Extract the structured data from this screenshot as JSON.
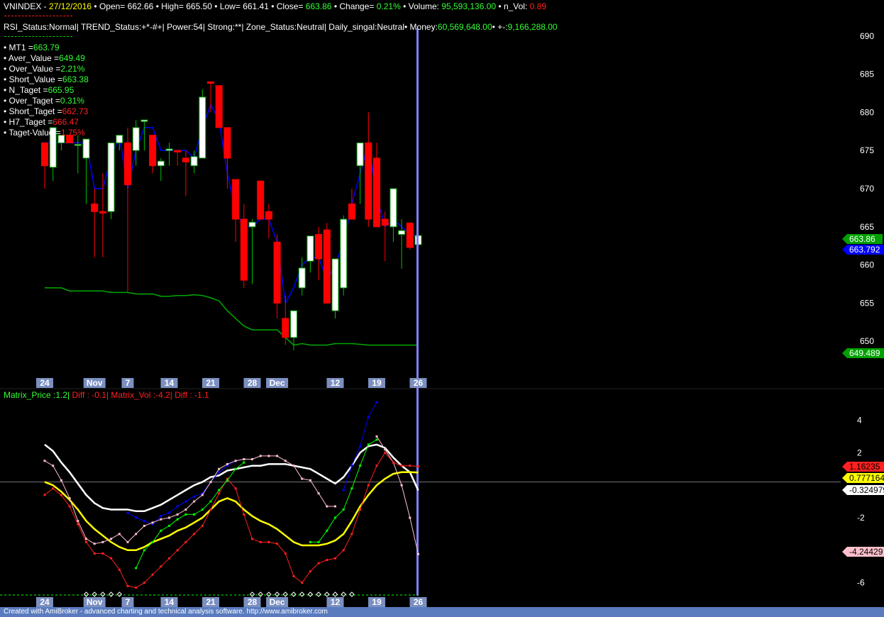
{
  "header": {
    "line1": [
      {
        "label": "VNINDEX",
        "value": "",
        "lc": "white"
      },
      {
        "label": " - ",
        "value": "27/12/2016",
        "lc": "white",
        "vc": "yellow"
      },
      {
        "label": " • Open= ",
        "value": "662.66",
        "lc": "white",
        "vc": "white"
      },
      {
        "label": " • High= ",
        "value": "665.50",
        "lc": "white",
        "vc": "white"
      },
      {
        "label": " • Low= ",
        "value": "661.41",
        "lc": "white",
        "vc": "white"
      },
      {
        "label": " • Close= ",
        "value": "663.86",
        "lc": "white",
        "vc": "lime"
      },
      {
        "label": " • Change= ",
        "value": "0.21%",
        "lc": "white",
        "vc": "lime"
      },
      {
        "label": " • Volume: ",
        "value": "95,593,136.00",
        "lc": "white",
        "vc": "lime"
      },
      {
        "label": " • n_Vol: ",
        "value": "0.89",
        "lc": "white",
        "vc": "red"
      }
    ],
    "line2": [
      {
        "label": "RSI_Status:",
        "value": "Normal",
        "lc": "white",
        "vc": "white"
      },
      {
        "label": "| TREND_Status:",
        "value": "+*-#+",
        "lc": "white",
        "vc": "white"
      },
      {
        "label": "| Power:",
        "value": "54",
        "lc": "white",
        "vc": "white"
      },
      {
        "label": "| Strong:",
        "value": "**",
        "lc": "white",
        "vc": "white"
      },
      {
        "label": "| Zone_Status:",
        "value": "Neutral",
        "lc": "white",
        "vc": "white"
      },
      {
        "label": "| Daily_singal:",
        "value": "Neutral",
        "lc": "white",
        "vc": "white"
      },
      {
        "label": "• Money:",
        "value": "60,569,648.00",
        "lc": "white",
        "vc": "lime"
      },
      {
        "label": "• +-:",
        "value": "9,166,288.00",
        "lc": "white",
        "vc": "lime"
      }
    ],
    "stats": [
      {
        "label": "• MT1 =",
        "value": "663.79",
        "vc": "lime"
      },
      {
        "label": "• Aver_Value =",
        "value": "649.49",
        "vc": "lime"
      },
      {
        "label": "• Over_Value =",
        "value": "2.21%",
        "vc": "lime"
      },
      {
        "label": "• Short_Value =",
        "value": "663.38",
        "vc": "lime"
      },
      {
        "label": "• N_Taget =",
        "value": "665.95",
        "vc": "lime"
      },
      {
        "label": "• Over_Taget =",
        "value": "0.31%",
        "vc": "lime"
      },
      {
        "label": "• Short_Taget =",
        "value": "662.73",
        "vc": "red"
      },
      {
        "label": "• H7_Taget =",
        "value": "666.47",
        "vc": "red"
      },
      {
        "label": "• Taget-Value =",
        "value": "1.75%",
        "vc": "red"
      }
    ]
  },
  "lower_header": [
    {
      "text": "Matrix_Price :1.2|",
      "color": "lime"
    },
    {
      "text": "  Diff : -0.1|",
      "color": "red"
    },
    {
      "text": " Matrix_Vol :-4.2|",
      "color": "red"
    },
    {
      "text": "  Diff : -1.1",
      "color": "red"
    }
  ],
  "footer": "Created with AmiBroker - advanced charting and technical analysis software. http://www.amibroker.com",
  "colors": {
    "up_body": "#ffffff",
    "down_body": "#ff0000",
    "ma": "#0000ff",
    "aver": "#00aa00",
    "cursor": "#8080ff",
    "badge_date": "#7b8fc0"
  },
  "chart_data": [
    {
      "type": "candlestick",
      "title": "",
      "ylim": [
        649,
        691
      ],
      "yticks": [
        650,
        655,
        660,
        665,
        670,
        675,
        680,
        685,
        690
      ],
      "x_tick_labels": [
        {
          "label": "24",
          "i": 0
        },
        {
          "label": "Nov",
          "i": 6
        },
        {
          "label": "7",
          "i": 10
        },
        {
          "label": "14",
          "i": 15
        },
        {
          "label": "21",
          "i": 20
        },
        {
          "label": "28",
          "i": 25
        },
        {
          "label": "Dec",
          "i": 28
        },
        {
          "label": "12",
          "i": 35
        },
        {
          "label": "19",
          "i": 40
        },
        {
          "label": "26",
          "i": 45
        }
      ],
      "ohlc": [
        [
          676,
          676,
          670,
          673
        ],
        [
          672.8,
          678,
          671,
          678
        ],
        [
          676,
          677,
          675,
          677
        ],
        [
          677,
          677,
          676,
          676
        ],
        [
          675.8,
          677,
          672,
          675.8
        ],
        [
          674,
          676.5,
          668,
          676.5
        ],
        [
          668,
          670,
          661,
          667
        ],
        [
          667,
          672,
          661,
          666.8
        ],
        [
          667,
          676,
          666,
          676
        ],
        [
          676,
          677,
          675,
          677
        ],
        [
          676,
          678,
          656.5,
          670.5
        ],
        [
          675,
          679,
          673,
          678
        ],
        [
          678.8,
          679,
          675,
          679
        ],
        [
          677,
          677,
          672,
          673
        ],
        [
          673,
          674,
          671,
          673.6
        ],
        [
          675,
          676,
          673,
          675.2
        ],
        [
          675,
          675,
          673,
          674.8
        ],
        [
          674,
          675,
          669,
          673.5
        ],
        [
          673,
          675,
          672,
          674.2
        ],
        [
          674,
          683,
          674,
          682
        ],
        [
          684,
          684,
          680,
          683.8
        ],
        [
          683.5,
          683.5,
          678,
          678
        ],
        [
          678,
          678,
          670,
          674
        ],
        [
          671.2,
          671.2,
          663,
          666
        ],
        [
          666,
          668,
          657,
          658
        ],
        [
          665,
          666,
          657.5,
          665.6
        ],
        [
          671,
          671,
          666,
          666
        ],
        [
          667,
          668,
          663.5,
          666
        ],
        [
          663,
          664,
          653,
          655
        ],
        [
          653,
          656,
          649.5,
          650.5
        ],
        [
          650.5,
          654,
          648.8,
          654
        ],
        [
          657,
          661,
          656,
          659.6
        ],
        [
          660.5,
          662,
          659,
          663.8
        ],
        [
          664,
          665,
          658,
          660.8
        ],
        [
          664.6,
          665.5,
          660,
          655
        ],
        [
          654,
          655,
          653,
          660.8
        ],
        [
          657,
          666.5,
          656,
          666
        ],
        [
          668,
          670,
          667,
          666
        ],
        [
          673,
          676,
          668,
          676
        ],
        [
          676,
          680,
          665,
          666
        ],
        [
          674,
          676,
          669,
          665
        ],
        [
          666,
          667,
          660.5,
          665.2
        ],
        [
          665,
          670,
          663,
          670
        ],
        [
          664,
          666,
          659.5,
          664.5
        ],
        [
          665.5,
          665.5,
          662,
          662.3
        ],
        [
          662.66,
          665.5,
          661.41,
          663.86
        ]
      ],
      "series": [
        {
          "name": "",
          "role": "ma",
          "values": [
            676,
            676,
            676,
            676,
            676,
            676,
            670,
            670,
            674,
            677,
            670,
            675,
            678,
            678,
            675,
            675,
            675,
            675,
            674,
            678,
            681,
            679,
            672,
            667,
            665,
            665,
            666,
            666,
            663,
            655,
            657,
            660,
            661,
            661,
            658,
            660,
            663,
            668,
            672,
            676,
            669,
            665,
            666,
            665,
            664,
            663.8
          ]
        },
        {
          "name": "",
          "role": "aver",
          "values": [
            657,
            657,
            657,
            656.6,
            656.6,
            656.6,
            656.6,
            656.6,
            656.4,
            656.4,
            656.4,
            656.2,
            656.2,
            656.2,
            655.9,
            655.9,
            656,
            656,
            656.1,
            656,
            655.7,
            655.3,
            654,
            653,
            652,
            651.5,
            651.5,
            651.5,
            651.5,
            650.5,
            649.5,
            649.7,
            649.5,
            649.5,
            649.5,
            649.7,
            649.7,
            649.7,
            649.6,
            649.5,
            649.5,
            649.5,
            649.5,
            649.5,
            649.5,
            649.5
          ]
        }
      ],
      "value_labels": [
        {
          "text": "663.86",
          "color": "#00a000",
          "value": 663.86
        },
        {
          "text": "663.792",
          "color": "#0000ff",
          "value": 663.792
        },
        {
          "text": "649.489",
          "color": "#00a000",
          "value": 649.489
        }
      ]
    },
    {
      "type": "line",
      "title": "",
      "ylim": [
        -6.8,
        5.2
      ],
      "yticks": [
        4,
        2,
        -2,
        -4,
        -6
      ],
      "zero_line": 0,
      "x_tick_labels": [
        {
          "label": "24",
          "i": 0
        },
        {
          "label": "Nov",
          "i": 6
        },
        {
          "label": "7",
          "i": 10
        },
        {
          "label": "14",
          "i": 15
        },
        {
          "label": "21",
          "i": 20
        },
        {
          "label": "28",
          "i": 25
        },
        {
          "label": "Dec",
          "i": 28
        },
        {
          "label": "12",
          "i": 35
        },
        {
          "label": "19",
          "i": 40
        },
        {
          "label": "26",
          "i": 45
        }
      ],
      "series": [
        {
          "name": "",
          "color": "#ffffff",
          "width": 2.5,
          "values": [
            2.5,
            2.1,
            1.4,
            0.8,
            0.1,
            -0.6,
            -1.1,
            -1.4,
            -1.5,
            -1.5,
            -1.5,
            -1.6,
            -1.6,
            -1.4,
            -1.2,
            -0.9,
            -0.6,
            -0.3,
            0.0,
            0.2,
            0.5,
            0.6,
            0.9,
            1.0,
            1.1,
            1.2,
            1.2,
            1.3,
            1.3,
            1.3,
            1.2,
            1.1,
            1.0,
            0.7,
            0.4,
            0.1,
            0.5,
            1.2,
            2.0,
            2.4,
            2.5,
            2.3,
            1.7,
            1.2,
            0.8,
            -0.32
          ]
        },
        {
          "name": "",
          "color": "#ffff00",
          "width": 2.5,
          "values": [
            0.2,
            0.0,
            -0.4,
            -0.9,
            -1.5,
            -2.2,
            -2.7,
            -3.1,
            -3.5,
            -3.8,
            -4.0,
            -4.0,
            -3.8,
            -3.5,
            -3.3,
            -3.1,
            -2.8,
            -2.6,
            -2.3,
            -2.0,
            -1.5,
            -1.0,
            -0.8,
            -1.0,
            -1.5,
            -1.9,
            -2.2,
            -2.4,
            -2.7,
            -3.1,
            -3.5,
            -3.7,
            -3.7,
            -3.7,
            -3.6,
            -3.4,
            -3.0,
            -2.2,
            -1.3,
            -0.6,
            0.0,
            0.4,
            0.7,
            0.8,
            0.8,
            0.78
          ]
        },
        {
          "name": "",
          "color": "#0000ff",
          "width": 1,
          "values": [
            null,
            null,
            null,
            null,
            null,
            null,
            null,
            null,
            null,
            null,
            -1.7,
            -2.0,
            -2.2,
            -2.4,
            -1.9,
            -1.7,
            -1.3,
            -1.0,
            -0.7,
            -0.5,
            0.2,
            0.8,
            1.2,
            1.5,
            1.6,
            null,
            null,
            null,
            null,
            null,
            null,
            null,
            null,
            null,
            null,
            null,
            -0.3,
            1.2,
            2.4,
            4.2,
            5.1,
            null,
            null,
            null,
            null,
            null
          ]
        },
        {
          "name": "",
          "color": "#ffc0cb",
          "width": 1,
          "values": [
            1.5,
            1.2,
            0.3,
            -0.8,
            -2.2,
            -3.3,
            -3.6,
            -3.5,
            -3.3,
            -3.0,
            -3.5,
            -3.0,
            -2.5,
            -2.3,
            -2.1,
            -2.0,
            -1.8,
            -1.5,
            -1.0,
            -0.6,
            0.2,
            1.0,
            1.3,
            1.5,
            1.6,
            1.6,
            1.8,
            1.8,
            1.8,
            1.5,
            1.2,
            0.4,
            0.3,
            -0.5,
            -1.3,
            -1.3,
            null,
            null,
            null,
            null,
            3.0,
            2.2,
            1.4,
            0.0,
            -2.0,
            -4.24
          ]
        },
        {
          "name": "",
          "color": "#ff2020",
          "width": 1,
          "values": [
            -0.6,
            -0.2,
            -0.6,
            -1.3,
            -2.4,
            -3.5,
            -4.2,
            -4.2,
            -4.5,
            -5.2,
            -6.2,
            -6.3,
            -6.0,
            -5.5,
            -5.0,
            -4.5,
            -4.0,
            -3.5,
            -3.0,
            -2.5,
            -1.5,
            -0.5,
            0.4,
            -0.2,
            -1.8,
            -3.3,
            -3.5,
            -3.5,
            -3.6,
            -4.2,
            -5.6,
            -6.0,
            -5.3,
            -4.8,
            -4.6,
            -4.5,
            -4.0,
            -3.0,
            -1.5,
            0.0,
            1.2,
            2.0,
            1.4,
            1.2,
            1.2,
            1.16
          ]
        },
        {
          "name": "",
          "color": "#00ff00",
          "width": 1,
          "values": [
            null,
            null,
            null,
            null,
            null,
            null,
            null,
            null,
            null,
            null,
            null,
            -5.1,
            -4.0,
            -3.5,
            -2.8,
            -2.5,
            -2.1,
            -1.8,
            -1.8,
            -1.5,
            -1.0,
            -0.3,
            0.3,
            1.0,
            1.4,
            null,
            null,
            null,
            null,
            null,
            null,
            null,
            -3.5,
            -3.5,
            -2.8,
            -2.0,
            -1.5,
            -0.2,
            1.2,
            2.5,
            2.8,
            null,
            null,
            null,
            null,
            null
          ]
        }
      ],
      "value_labels": [
        {
          "text": "1.16235",
          "color": "#ff2020",
          "fg": "#000000",
          "value": 1.16235
        },
        {
          "text": "0.777164",
          "color": "#ffff00",
          "fg": "#000000",
          "value": 0.777164
        },
        {
          "text": "-0.324979",
          "color": "#ffffff",
          "fg": "#000000",
          "value": -0.324979
        },
        {
          "text": "-4.24429",
          "color": "#ffc0cb",
          "fg": "#000000",
          "value": -4.24429
        }
      ]
    }
  ]
}
